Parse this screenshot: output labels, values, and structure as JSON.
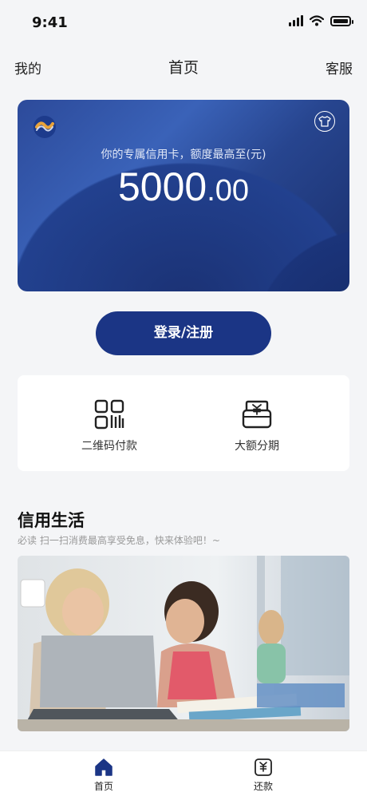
{
  "status_bar": {
    "time": "9:41"
  },
  "nav": {
    "left": "我的",
    "title": "首页",
    "right": "客服"
  },
  "card": {
    "caption": "你的专属信用卡，额度最高至(元)",
    "amount_integer": "5000",
    "amount_decimal": ".00"
  },
  "login_button": "登录/注册",
  "services": [
    {
      "label": "二维码付款",
      "icon": "qr-code-icon"
    },
    {
      "label": "大额分期",
      "icon": "installment-icon"
    }
  ],
  "section": {
    "title": "信用生活",
    "subtitle": "必读 扫一扫消费最高享受免息，快来体验吧！~"
  },
  "tabs": [
    {
      "label": "首页",
      "icon": "home-icon",
      "active": true
    },
    {
      "label": "还款",
      "icon": "repay-icon",
      "active": false
    }
  ],
  "colors": {
    "accent": "#1b3585",
    "background": "#f4f5f7"
  }
}
